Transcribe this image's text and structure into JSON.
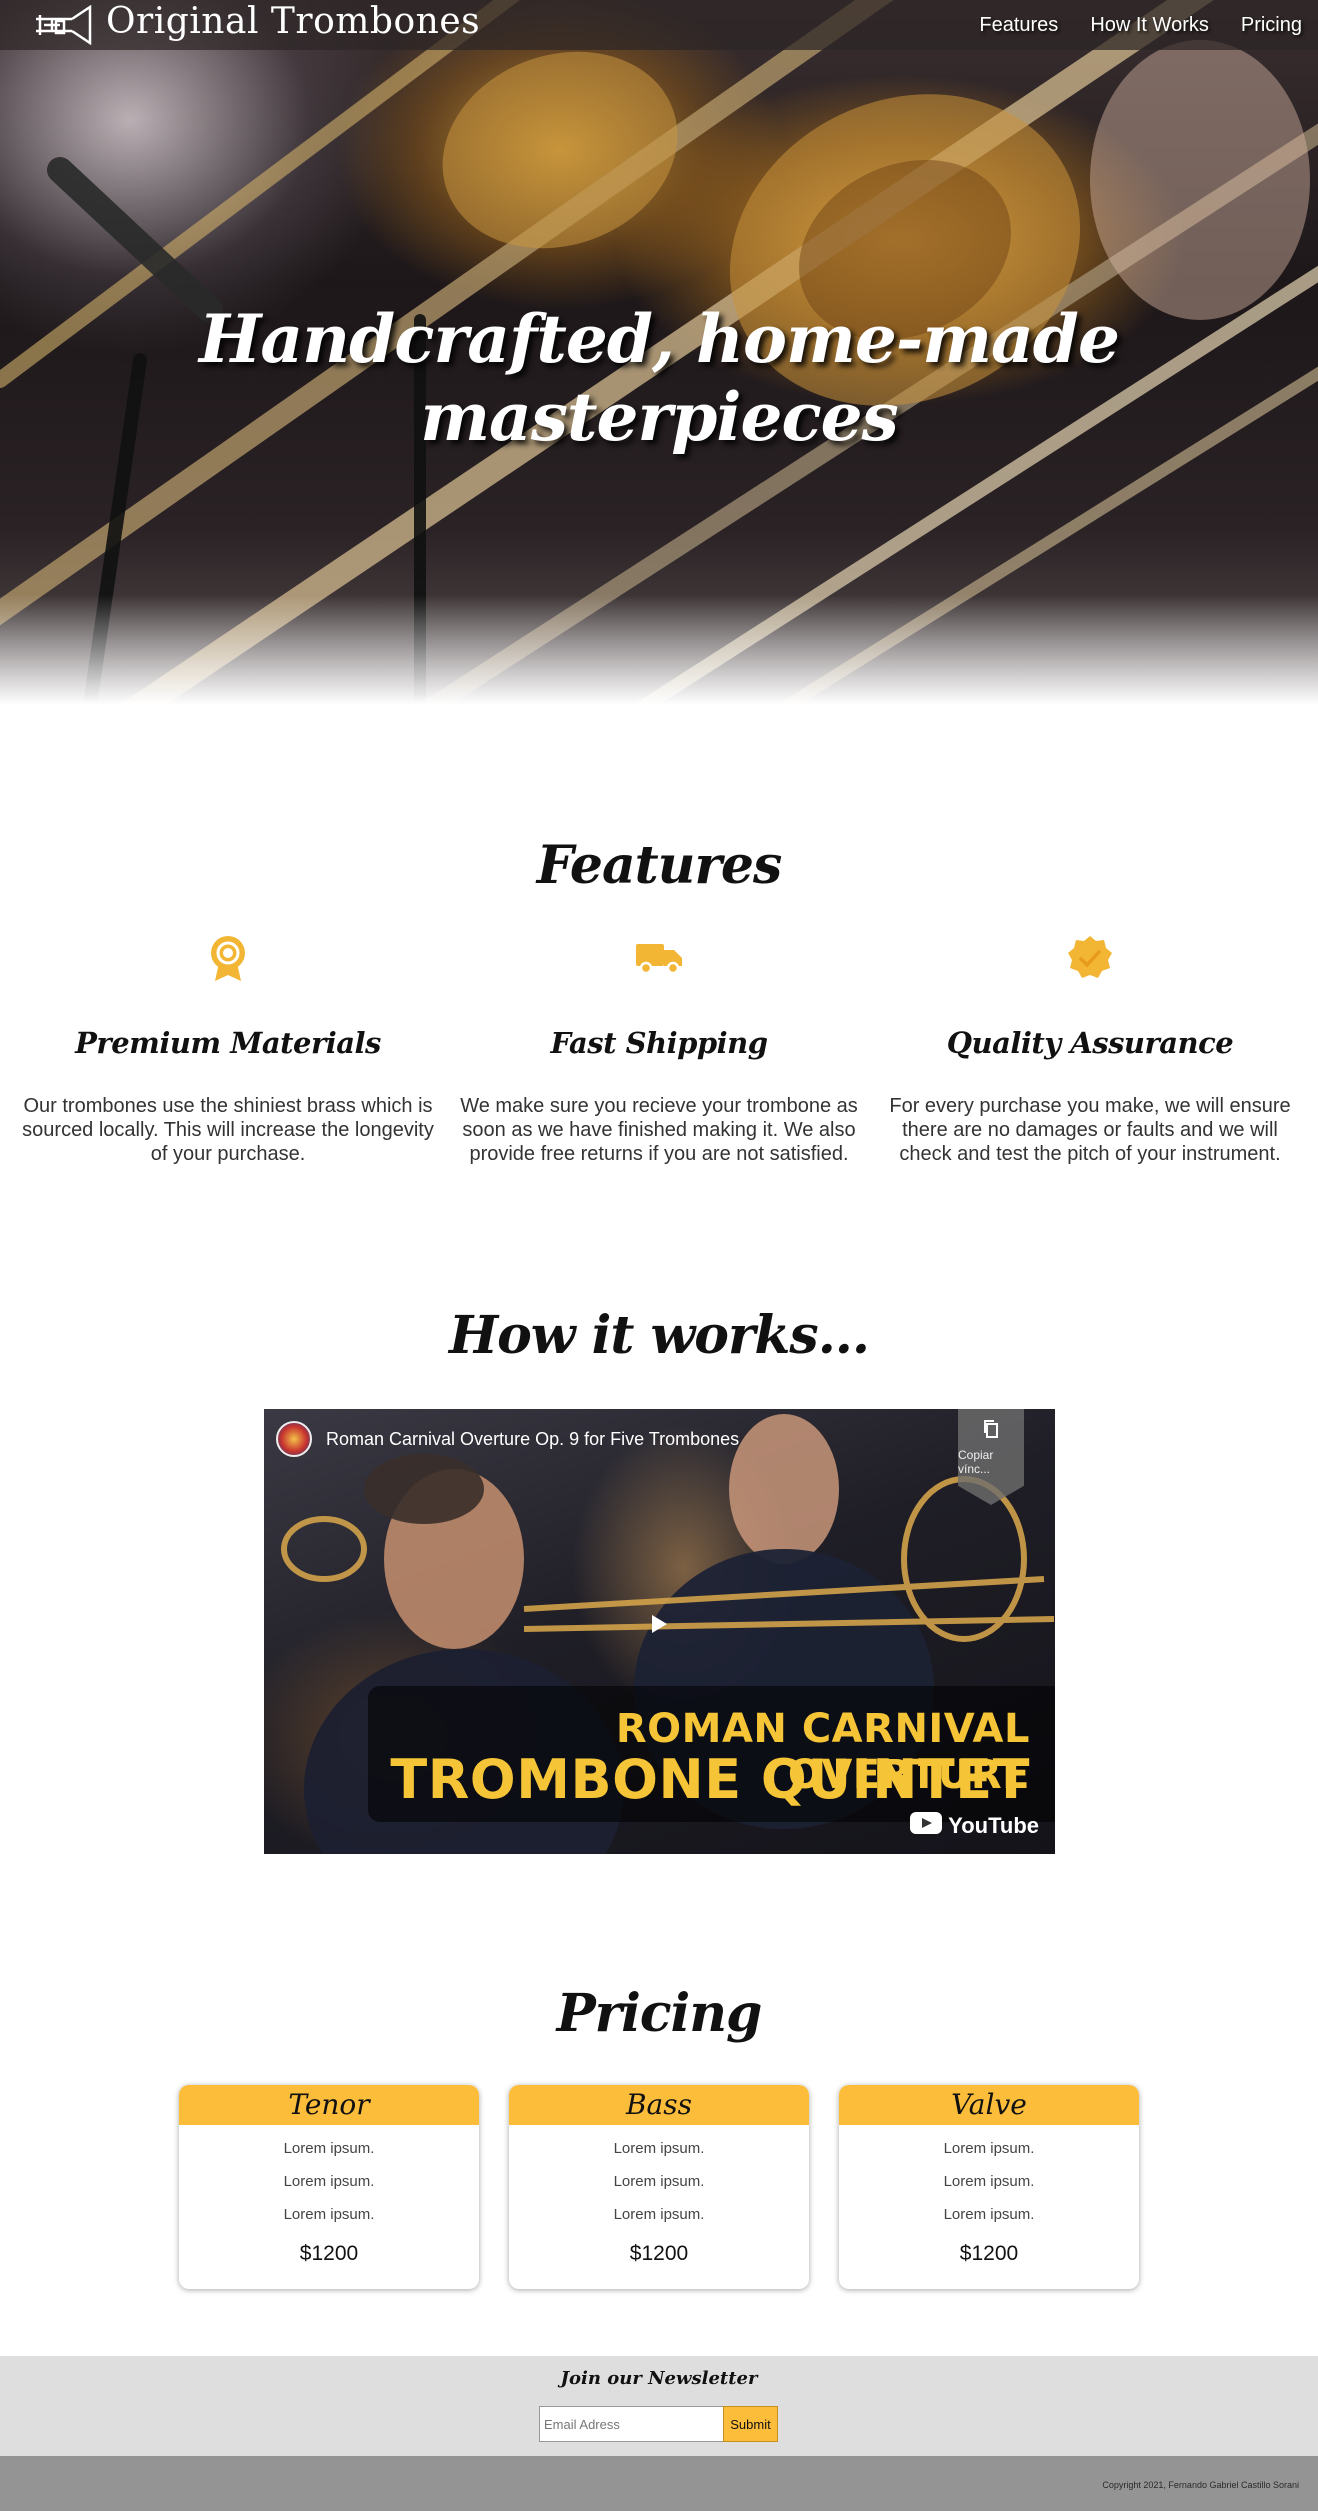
{
  "header": {
    "brand_name": "Original Trombones",
    "nav": [
      "Features",
      "How It Works",
      "Pricing"
    ]
  },
  "hero": {
    "title": "Handcrafted, home-made masterpieces"
  },
  "features": {
    "title": "Features",
    "items": [
      {
        "icon": "award-medal-icon",
        "title": "Premium Materials",
        "text": "Our trombones use the shiniest brass which is sourced locally. This will increase the longevity of your purchase."
      },
      {
        "icon": "truck-icon",
        "title": "Fast Shipping",
        "text": "We make sure you recieve your trombone as soon as we have finished making it. We also provide free returns if you are not satisfied."
      },
      {
        "icon": "check-badge-icon",
        "title": "Quality Assurance",
        "text": "For every purchase you make, we will ensure there are no damages or faults and we will check and test the pitch of your instrument."
      }
    ]
  },
  "how": {
    "title": "How it works...",
    "video": {
      "title": "Roman Carnival Overture Op. 9 for Five Trombones",
      "copy_label": "Copiar vínc...",
      "banner_line1": "ROMAN CARNIVAL OVERTURE",
      "banner_line2": "TROMBONE QUINTET",
      "platform": "YouTube"
    }
  },
  "pricing": {
    "title": "Pricing",
    "plans": [
      {
        "name": "Tenor",
        "lines": [
          "Lorem ipsum.",
          "Lorem ipsum.",
          "Lorem ipsum."
        ],
        "price": "$1200"
      },
      {
        "name": "Bass",
        "lines": [
          "Lorem ipsum.",
          "Lorem ipsum.",
          "Lorem ipsum."
        ],
        "price": "$1200"
      },
      {
        "name": "Valve",
        "lines": [
          "Lorem ipsum.",
          "Lorem ipsum.",
          "Lorem ipsum."
        ],
        "price": "$1200"
      }
    ]
  },
  "newsletter": {
    "title": "Join our Newsletter",
    "email_placeholder": "Email Adress",
    "submit_label": "Submit"
  },
  "footer": {
    "copyright": "Copyright 2021, Fernando Gabriel Castillo Sorani"
  },
  "colors": {
    "accent": "#fbbd3a",
    "newsletter_bg": "#dedede",
    "footer_bg": "#949494"
  }
}
